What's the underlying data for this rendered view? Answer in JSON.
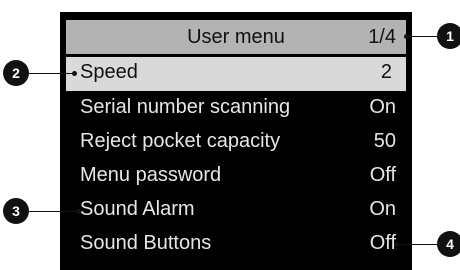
{
  "header": {
    "title": "User menu",
    "page_indicator": "1/4"
  },
  "menu": {
    "items": [
      {
        "label": "Speed",
        "value": "2",
        "selected": true
      },
      {
        "label": "Serial number scanning",
        "value": "On"
      },
      {
        "label": "Reject pocket capacity",
        "value": "50"
      },
      {
        "label": "Menu password",
        "value": "Off"
      },
      {
        "label": "Sound Alarm",
        "value": "On"
      },
      {
        "label": "Sound Buttons",
        "value": "Off"
      }
    ]
  },
  "callouts": [
    "1",
    "2",
    "3",
    "4"
  ]
}
